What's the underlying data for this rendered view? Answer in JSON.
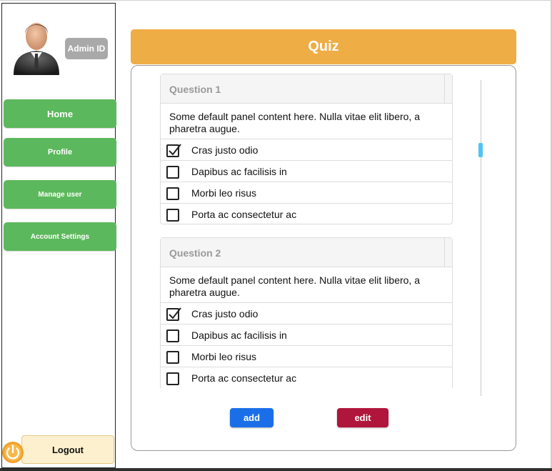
{
  "sidebar": {
    "admin_badge": "Admin ID",
    "nav": [
      {
        "label": "Home"
      },
      {
        "label": "Profile"
      },
      {
        "label": "Manage user"
      },
      {
        "label": "Account Settings"
      }
    ],
    "logout_label": "Logout"
  },
  "quiz": {
    "title": "Quiz",
    "questions": [
      {
        "title": "Question 1",
        "content": "Some default panel content here. Nulla vitae elit libero, a pharetra augue.",
        "options": [
          {
            "label": "Cras justo odio",
            "checked": true
          },
          {
            "label": "Dapibus ac facilisis in",
            "checked": false
          },
          {
            "label": "Morbi leo risus",
            "checked": false
          },
          {
            "label": "Porta ac consectetur ac",
            "checked": false
          }
        ]
      },
      {
        "title": "Question 2",
        "content": "Some default panel content here. Nulla vitae elit libero, a pharetra augue.",
        "options": [
          {
            "label": "Cras justo odio",
            "checked": true
          },
          {
            "label": "Dapibus ac facilisis in",
            "checked": false
          },
          {
            "label": "Morbi leo risus",
            "checked": false
          },
          {
            "label": "Porta ac consectetur ac",
            "checked": false
          }
        ]
      }
    ],
    "add_label": "add",
    "edit_label": "edit"
  },
  "colors": {
    "nav_green": "#5cb85c",
    "quiz_header": "#efad45",
    "add_button": "#1a6fe8",
    "edit_button": "#b0153b",
    "logout_bg": "#fdf0cf",
    "scroll_thumb": "#4fc3f7"
  },
  "icons": {
    "avatar": "businessman-avatar-icon",
    "power": "power-icon",
    "checkbox_checked": "checkmark-icon"
  }
}
